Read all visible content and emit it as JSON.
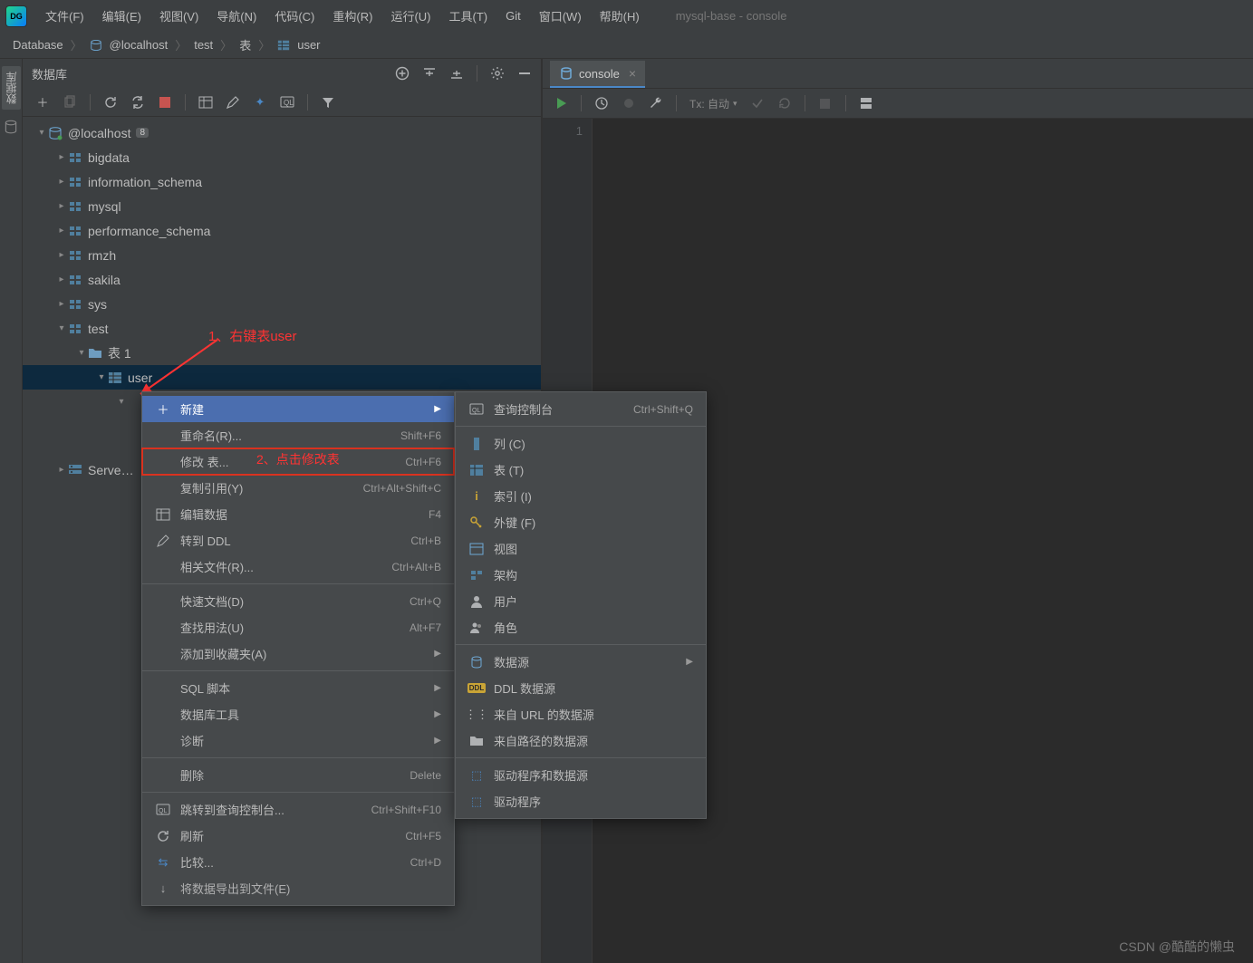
{
  "window_title": "mysql-base - console",
  "menus": [
    "文件(F)",
    "编辑(E)",
    "视图(V)",
    "导航(N)",
    "代码(C)",
    "重构(R)",
    "运行(U)",
    "工具(T)",
    "Git",
    "窗口(W)",
    "帮助(H)"
  ],
  "breadcrumbs": {
    "a": "Database",
    "b": "@localhost",
    "c": "test",
    "d": "表",
    "e": "user"
  },
  "sidebar": {
    "title": "数据库",
    "host": "@localhost",
    "host_badge": "8",
    "schemas": [
      "bigdata",
      "information_schema",
      "mysql",
      "performance_schema",
      "rmzh",
      "sakila",
      "sys",
      "test"
    ],
    "test_folder": "表 1",
    "table_name": "user",
    "server_obj": "Server Objects"
  },
  "editor": {
    "tab": "console",
    "tx": "Tx: 自动",
    "line": "1"
  },
  "ctx1": {
    "new": "新建",
    "rename": {
      "l": "重命名(R)...",
      "s": "Shift+F6"
    },
    "modify": {
      "l": "修改 表...",
      "s": "Ctrl+F6"
    },
    "copyref": {
      "l": "复制引用(Y)",
      "s": "Ctrl+Alt+Shift+C"
    },
    "editdata": {
      "l": "编辑数据",
      "s": "F4"
    },
    "gotoddl": {
      "l": "转到 DDL",
      "s": "Ctrl+B"
    },
    "related": {
      "l": "相关文件(R)...",
      "s": "Ctrl+Alt+B"
    },
    "quickdoc": {
      "l": "快速文档(D)",
      "s": "Ctrl+Q"
    },
    "findusage": {
      "l": "查找用法(U)",
      "s": "Alt+F7"
    },
    "addfav": {
      "l": "添加到收藏夹(A)",
      "s": ""
    },
    "sqlscript": {
      "l": "SQL 脚本",
      "s": ""
    },
    "dbtools": {
      "l": "数据库工具",
      "s": ""
    },
    "diag": {
      "l": "诊断",
      "s": ""
    },
    "delete": {
      "l": "删除",
      "s": "Delete"
    },
    "jumpconsole": {
      "l": "跳转到查询控制台...",
      "s": "Ctrl+Shift+F10"
    },
    "refresh": {
      "l": "刷新",
      "s": "Ctrl+F5"
    },
    "compare": {
      "l": "比较...",
      "s": "Ctrl+D"
    },
    "export": {
      "l": "将数据导出到文件(E)",
      "s": ""
    }
  },
  "ctx2": {
    "queryconsole": {
      "l": "查询控制台",
      "s": "Ctrl+Shift+Q"
    },
    "column": "列 (C)",
    "table": "表 (T)",
    "index": "索引 (I)",
    "fk": "外键 (F)",
    "view": "视图",
    "schema": "架构",
    "user": "用户",
    "role": "角色",
    "datasource": "数据源",
    "ddlds": "DDL 数据源",
    "urlds": "来自 URL 的数据源",
    "pathds": "来自路径的数据源",
    "driverds": "驱动程序和数据源",
    "driver": "驱动程序"
  },
  "annotations": {
    "a1": "1、右键表user",
    "a2": "2、点击修改表"
  },
  "watermark": "CSDN @酷酷的懒虫"
}
